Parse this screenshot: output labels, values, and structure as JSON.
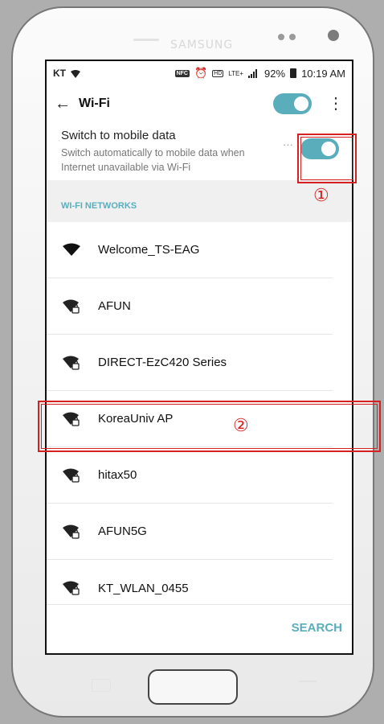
{
  "status_bar": {
    "carrier": "KT",
    "nfc": "NFC",
    "hd": "HD",
    "lte": "LTE+",
    "battery": "92%",
    "time": "10:19 AM"
  },
  "toolbar": {
    "back_icon": "←",
    "title": "Wi-Fi",
    "wifi_toggle": "on",
    "menu_icon": "⋮"
  },
  "mobile_data": {
    "title": "Switch to mobile data",
    "subtitle": "Switch automatically to mobile data when Internet unavailable via Wi-Fi",
    "more": "···",
    "toggle": "on"
  },
  "networks": {
    "header": "WI-FI NETWORKS",
    "items": [
      {
        "name": "Welcome_TS-EAG",
        "secured": false
      },
      {
        "name": "AFUN",
        "secured": true
      },
      {
        "name": "DIRECT-EzC420 Series",
        "secured": true
      },
      {
        "name": "KoreaUniv AP",
        "secured": true
      },
      {
        "name": "hitax50",
        "secured": true
      },
      {
        "name": "AFUN5G",
        "secured": true
      },
      {
        "name": "KT_WLAN_0455",
        "secured": true
      }
    ]
  },
  "footer": {
    "search_label": "SEARCH"
  },
  "device": {
    "brand": "SAMSUNG"
  },
  "annotations": {
    "marker_1": "①",
    "marker_2": "②",
    "color": "#d72020"
  },
  "colors": {
    "accent": "#5aaebc"
  }
}
